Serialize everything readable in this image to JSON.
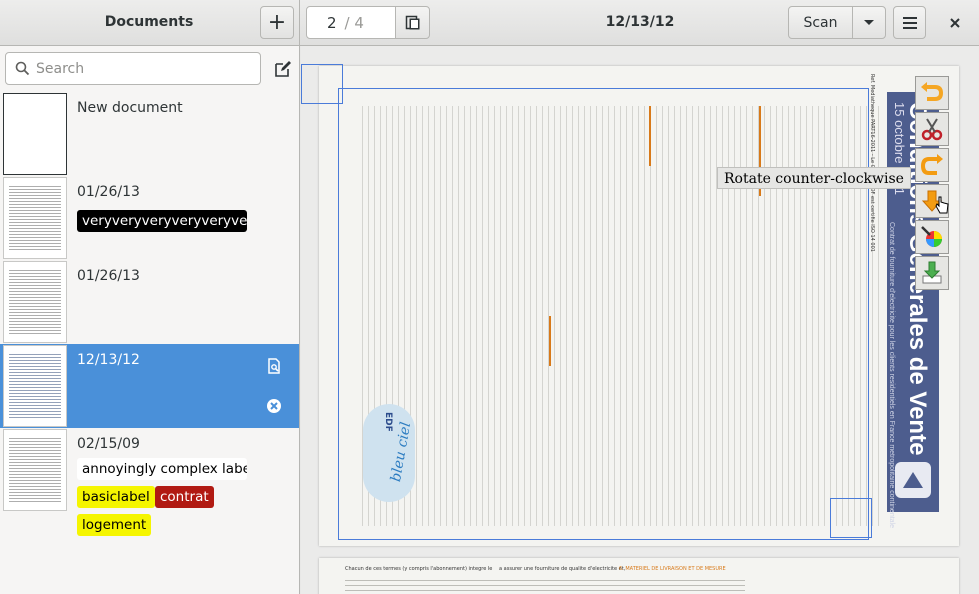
{
  "header": {
    "sidebar_title": "Documents",
    "add_label": "+",
    "page_current": "2",
    "page_total": "/ 4",
    "document_title": "12/13/12",
    "scan_label": "Scan"
  },
  "sidebar": {
    "search_placeholder": "Search",
    "documents": [
      {
        "date": "New document",
        "labels": []
      },
      {
        "date": "01/26/13",
        "labels": [
          {
            "text": "veryveryveryveryveryver",
            "bg": "#000000",
            "fg": "#ffffff"
          }
        ]
      },
      {
        "date": "01/26/13",
        "labels": []
      },
      {
        "date": "12/13/12",
        "labels": [],
        "selected": true
      },
      {
        "date": "02/15/09",
        "labels": [
          {
            "text": "annoyingly complex labe",
            "bg": "#ffffff",
            "fg": "#000000"
          },
          {
            "text": "basiclabel",
            "bg": "#f5f500",
            "fg": "#000000"
          },
          {
            "text": "contrat",
            "bg": "#b11a12",
            "fg": "#ffffff"
          },
          {
            "text": "logement",
            "bg": "#f5f500",
            "fg": "#000000"
          }
        ]
      }
    ]
  },
  "viewer": {
    "tooltip": "Rotate counter-clockwise",
    "tools": [
      "rotate-clockwise-icon",
      "scissors-icon",
      "rotate-counter-clockwise-icon",
      "move-down-icon",
      "color-picker-icon",
      "download-icon"
    ],
    "page_texts": {
      "ref": "Ref. Mediatheque PART16-2011 - Le Groupe EDF est certifie ISO 14 001",
      "title": "Conditions Generales de Vente",
      "subtitle": "Contrat de fourniture d'electricite pour les clients residentiels en France metropolitaine continentale",
      "date": "15 octobre 2011",
      "logo1": "EDF",
      "logo2": "bleu ciel",
      "p2_col1": "Chacun de ces termes (y compris l'abonnement) integre le",
      "p2_col2": "a assurer une fourniture de qualite d'electricite et,",
      "p2_col3": "6. MATERIEL DE LIVRAISON ET DE MESURE"
    }
  },
  "colors": {
    "selection": "#4a90d9",
    "accent_orange": "#f5a623",
    "brand_blue": "#4d5d8e"
  }
}
